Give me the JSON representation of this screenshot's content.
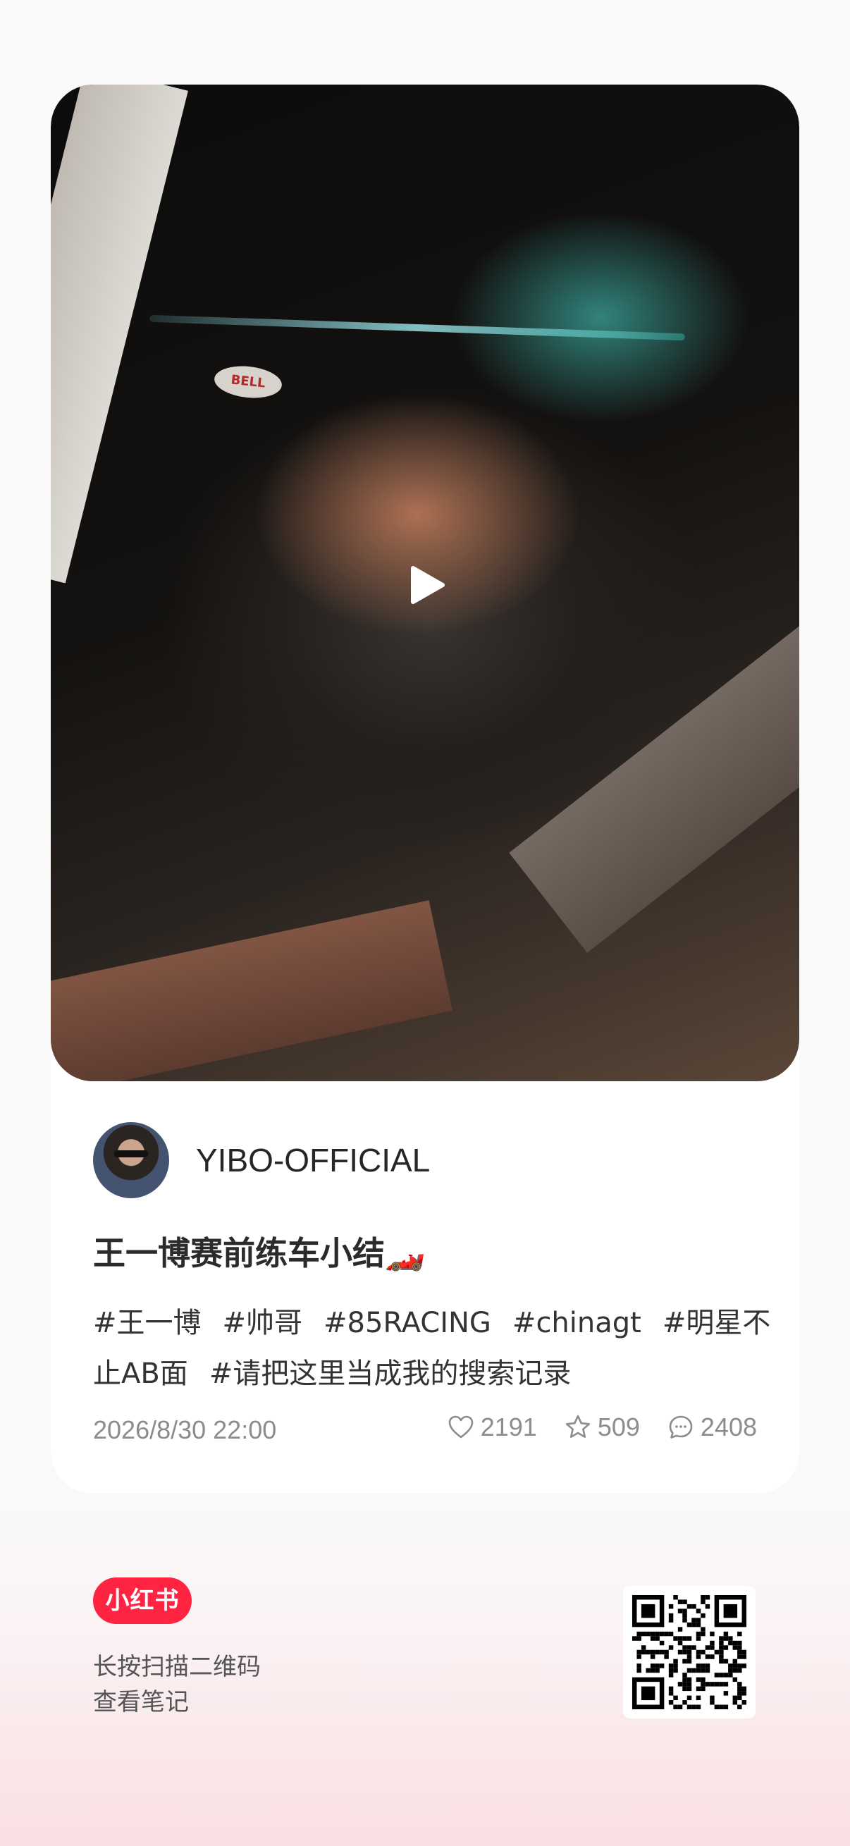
{
  "post": {
    "username": "YIBO-OFFICIAL",
    "title": "王一博赛前练车小结🏎️",
    "tags_line1": [
      "#王一博",
      "#帅哥",
      "#85RACING",
      "#chinagt",
      "#明星不"
    ],
    "tags_line2": [
      "止AB面",
      "#请把这里当成我的搜索记录"
    ],
    "datetime": "2026/8/30 22:00",
    "likes": "2191",
    "collects": "509",
    "comments": "2408",
    "cover": {
      "helmet_brand": "BELL",
      "play_icon": "play-icon"
    }
  },
  "footer": {
    "brand": "小红书",
    "scan_line1": "长按扫描二维码",
    "scan_line2": "查看笔记",
    "qr_icon": "qr-code"
  },
  "colors": {
    "brand": "#ff2442",
    "text_primary": "#2b2b2b",
    "text_secondary": "#8c8c8c"
  }
}
